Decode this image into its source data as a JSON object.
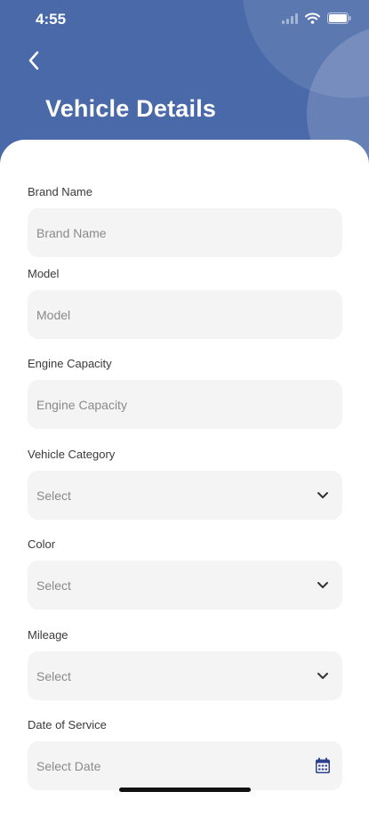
{
  "status_bar": {
    "time": "4:55",
    "icons": [
      "signal-icon",
      "wifi-icon",
      "battery-icon"
    ]
  },
  "header": {
    "title": "Vehicle Details",
    "back_icon": "chevron-left-icon",
    "background_color": "#4a69a9"
  },
  "form": {
    "brand_name": {
      "label": "Brand Name",
      "placeholder": "Brand Name"
    },
    "model": {
      "label": "Model",
      "placeholder": "Model"
    },
    "engine_capacity": {
      "label": "Engine Capacity",
      "placeholder": "Engine Capacity"
    },
    "vehicle_category": {
      "label": "Vehicle Category",
      "value": "Select",
      "icon": "chevron-down-icon"
    },
    "color": {
      "label": "Color",
      "value": "Select",
      "icon": "chevron-down-icon"
    },
    "mileage": {
      "label": "Mileage",
      "value": "Select",
      "icon": "chevron-down-icon"
    },
    "date_of_service": {
      "label": "Date of Service",
      "value": "Select Date",
      "icon": "calendar-icon"
    }
  },
  "colors": {
    "field_background": "#f4f4f4",
    "calendar_icon": "#2b3f8c"
  }
}
